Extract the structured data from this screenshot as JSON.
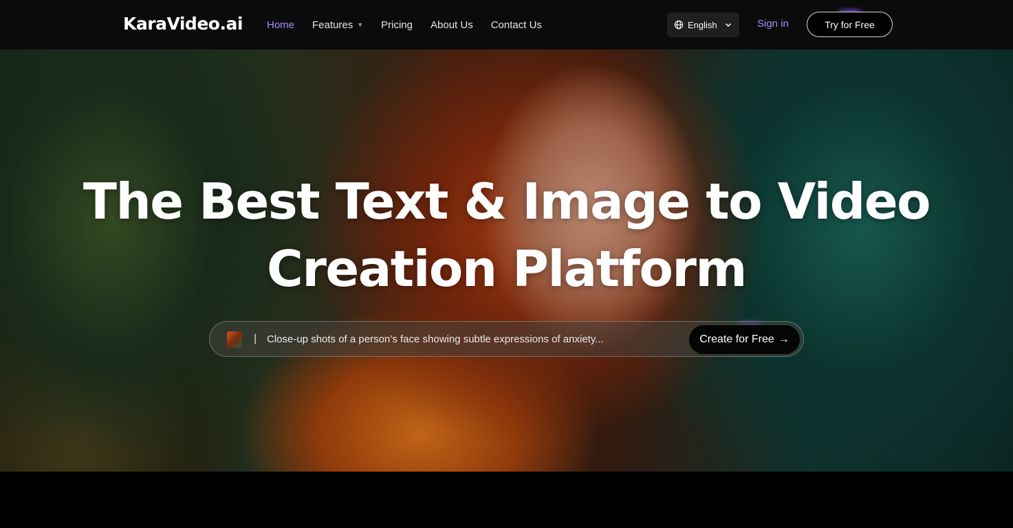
{
  "brand": {
    "logo_text": "KaraVideo.ai"
  },
  "nav": {
    "items": [
      {
        "label": "Home",
        "active": true
      },
      {
        "label": "Features",
        "has_dropdown": true
      },
      {
        "label": "Pricing"
      },
      {
        "label": "About Us"
      },
      {
        "label": "Contact Us"
      }
    ]
  },
  "language": {
    "selected": "English",
    "icon": "globe-icon"
  },
  "auth": {
    "sign_in": "Sign in",
    "try_free": "Try for Free"
  },
  "hero": {
    "headline_line1": "The Best Text & Image to Video",
    "headline_line2": "Creation Platform",
    "prompt_cursor": "|",
    "prompt_placeholder": "Close-up shots of a person’s face showing subtle expressions of anxiety...",
    "cta_label": "Create for Free",
    "cta_arrow": "→"
  },
  "colors": {
    "accent": "#a78bfa",
    "nav_bg": "#0b0b0c",
    "button_bg": "#050505"
  }
}
